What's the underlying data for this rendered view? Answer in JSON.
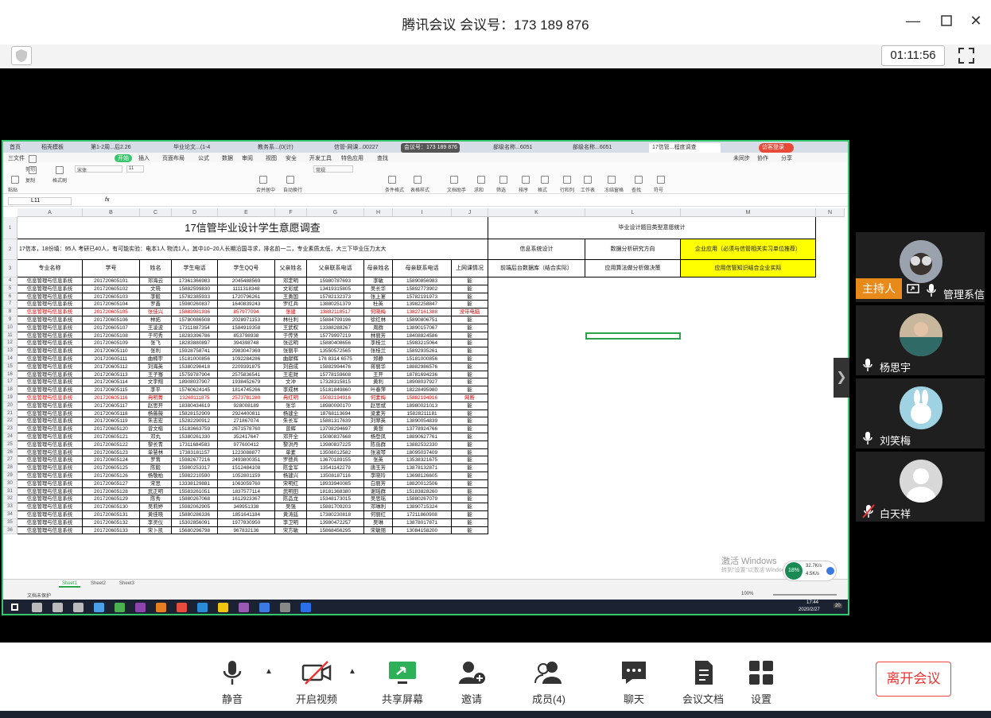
{
  "window": {
    "title": "腾讯会议 会议号：173 189 876",
    "timer": "01:11:56"
  },
  "shared_screen": {
    "tabs": [
      "首页",
      "稻壳模板",
      "第1-2周...后2.26",
      "毕业论文...(1-4",
      "教务系...(0(计)",
      "信管-网课...00227",
      "部级名称...6051",
      "部级名称...6051",
      "17信管...程度调查",
      "访客登录"
    ],
    "menus": [
      "三文件",
      "开始",
      "插入",
      "页面布局",
      "公式",
      "数据",
      "审阅",
      "视图",
      "安全",
      "开发工具",
      "特色应用",
      "查找"
    ],
    "menus_right": [
      "未同步",
      "协作",
      "分享"
    ],
    "sharing_badge": "会议号：173 189 876",
    "ribbon": {
      "font_name": "宋体",
      "font_size": "11",
      "number_format": "常规",
      "items": [
        "粘贴",
        "剪切",
        "复制",
        "格式刷",
        "合并居中",
        "自动换行",
        "条件格式",
        "表格样式",
        "文档助手",
        "求和",
        "筛选",
        "排序",
        "格式",
        "行和列",
        "工作表",
        "冻结窗格",
        "查找",
        "符号"
      ]
    },
    "name_box": "L11",
    "fx": "fx",
    "columns": [
      "A",
      "B",
      "C",
      "D",
      "E",
      "F",
      "G",
      "H",
      "I",
      "J",
      "K",
      "L",
      "M",
      "N"
    ],
    "sheet_title": "17信管毕业设计学生意愿调查",
    "summary": "17信本，18份填：95人 考研已40人，有可能实验：电本1人 物流1人，其中10~20人长期沿国寻求，排名前一二，专业素质太低，大三下毕业压力太大",
    "headers": [
      "专业名称",
      "学号",
      "姓名",
      "学生电话",
      "学生QQ号",
      "父亲姓名",
      "父亲联系电话",
      "母亲姓名",
      "母亲联系电话",
      "上网课情况"
    ],
    "side_title": "毕业设计题目类型意愿统计",
    "side_cols": [
      "信息系统设计",
      "数据分析研究方向",
      "企业应用（必须与信管相关实习单位推荐）"
    ],
    "side_row3": [
      "前端后台数据库（结合实际）",
      "应用算法做分析做决策",
      "应用信管知识结合企业实际"
    ],
    "rows": [
      [
        "信息管理与信息系统",
        "201720605101",
        "邓海云",
        "17361366983",
        "2045488569",
        "邓定明",
        "15980787693",
        "李敏",
        "15890856983",
        "能"
      ],
      [
        "信息管理与信息系统",
        "201720605102",
        "文晓",
        "15882599830",
        "1111318348",
        "文彩斌",
        "13419315805",
        "吴长华",
        "15892773902",
        "能"
      ],
      [
        "信息管理与信息系统",
        "201720605103",
        "李毅",
        "15782385933",
        "1720796261",
        "王勇国",
        "15782132373",
        "张上宴",
        "15782191973",
        "能"
      ],
      [
        "信息管理与信息系统",
        "201720605104",
        "罗鑫",
        "15980260837",
        "1640839243",
        "罗红兵",
        "13880251379",
        "杜英",
        "13982258847",
        "能"
      ],
      [
        "信息管理与信息系统",
        "201720605105",
        "张佳兴",
        "15883981936",
        "857977094",
        "张建",
        "13882118517",
        "何晓梅",
        "13827161388",
        "没带电脑"
      ],
      [
        "信息管理与信息系统",
        "201720605106",
        "林拓",
        "15780086508",
        "2028971153",
        "林仕利",
        "15884799196",
        "徐红林",
        "15890806751",
        "能"
      ],
      [
        "信息管理与信息系统",
        "201720605107",
        "王凌波",
        "17311887354",
        "1584919358",
        "王武权",
        "13388288267",
        "周群",
        "13890157067",
        "能"
      ],
      [
        "信息管理与信息系统",
        "201720605108",
        "于可秀",
        "18283396786",
        "853798938",
        "于传贤",
        "15779997219",
        "林丽芳",
        "18408824586",
        "能"
      ],
      [
        "信息管理与信息系统",
        "201720605109",
        "张飞",
        "18283880897",
        "394398748",
        "张远明",
        "15880408656",
        "李桂兰",
        "15983215064",
        "能"
      ],
      [
        "信息管理与信息系统",
        "201720605110",
        "张利",
        "15928758741",
        "2983047369",
        "张丽平",
        "13550572565",
        "张桂兰",
        "15892935261",
        "能"
      ],
      [
        "信息管理与信息系统",
        "201720605111",
        "曲楠宇",
        "15181000856",
        "1092284286",
        "曲献辉",
        "176 8314 6575",
        "郑静",
        "15181000856",
        "能"
      ],
      [
        "信息管理与信息系统",
        "201720605112",
        "刘海英",
        "15380296418",
        "2209391875",
        "刘自成",
        "15882994476",
        "蒋丽华",
        "18882986576",
        "能"
      ],
      [
        "信息管理与信息系统",
        "201720605113",
        "王子骞",
        "15759787904",
        "2575836541",
        "王宏财",
        "15778159608",
        "王开",
        "18781694236",
        "能"
      ],
      [
        "信息管理与信息系统",
        "201720605114",
        "文宇翔",
        "18908037907",
        "1938452679",
        "文冲",
        "17328315815",
        "黄利",
        "18908037927",
        "能"
      ],
      [
        "信息管理与信息系统",
        "201720605115",
        "李平",
        "15760624145",
        "1814745266",
        "李成林",
        "15181849860",
        "叶春萍",
        "18228495980",
        "能"
      ],
      [
        "信息管理与信息系统",
        "201720605116",
        "冉明菁",
        "13260111875",
        "2573781280",
        "冉红明",
        "15082194916",
        "何素梅",
        "15882194916",
        "网断"
      ],
      [
        "信息管理与信息系统",
        "201720605117",
        "赵思开",
        "18380434619",
        "928008189",
        "张华",
        "18980090170",
        "赵思斌",
        "18980021013",
        "能"
      ],
      [
        "信息管理与信息系统",
        "201720605118",
        "杨薇薇",
        "15828152909",
        "2924400811",
        "杨建全",
        "18768113694",
        "梁素芳",
        "15828211181",
        "能"
      ],
      [
        "信息管理与信息系统",
        "201720605119",
        "朱志宏",
        "15282290912",
        "271867074",
        "朱长军",
        "15881317639",
        "刘翠英",
        "13890054839",
        "能"
      ],
      [
        "信息管理与信息系统",
        "201720605120",
        "曾文楷",
        "15183663759",
        "2671578760",
        "曾辉",
        "13708294697",
        "黄想",
        "13778924766",
        "能"
      ],
      [
        "信息管理与信息系统",
        "201720605121",
        "邓丸",
        "15380261330",
        "352417647",
        "邓开全",
        "15080837668",
        "杨登凤",
        "18890627761",
        "能"
      ],
      [
        "信息管理与信息系统",
        "201720605122",
        "黎长青",
        "17311684583",
        "977600412",
        "黎洪丹",
        "13980837225",
        "陈岳群",
        "13882532330",
        "能"
      ],
      [
        "信息管理与信息系统",
        "201720605123",
        "单慧林",
        "17383181157",
        "1223088877",
        "单素",
        "13508012582",
        "张淑琴",
        "18095037409",
        "能"
      ],
      [
        "信息管理与信息系统",
        "201720605124",
        "罗茸",
        "15982677216",
        "2493800351",
        "罗德兵",
        "13670189155",
        "张英",
        "13538321675",
        "能"
      ],
      [
        "信息管理与信息系统",
        "201720605125",
        "陈毅",
        "15980253317",
        "1512484108",
        "陈金军",
        "13541142279",
        "唐玉芳",
        "13878132871",
        "能"
      ],
      [
        "信息管理与信息系统",
        "201720605126",
        "杨敬柏",
        "15982210590",
        "1052801159",
        "杨建兴",
        "13508187116",
        "李晓玲",
        "13698126605",
        "能"
      ],
      [
        "信息管理与信息系统",
        "201720605127",
        "宋思",
        "13338129881",
        "1063059760",
        "宋明红",
        "18933940085",
        "白丽芳",
        "18820012506",
        "能"
      ],
      [
        "信息管理与信息系统",
        "201720605128",
        "武正明",
        "15583261051",
        "1837577114",
        "武明田",
        "18181368380",
        "谢瑶群",
        "15183828260",
        "能"
      ],
      [
        "信息管理与信息系统",
        "201720605129",
        "陈秀",
        "15880267068",
        "1612923367",
        "陈品龙",
        "15348173015",
        "吴思瑶",
        "15880267079",
        "能"
      ],
      [
        "信息管理与信息系统",
        "201720605130",
        "吴莉婷",
        "15982062905",
        "349951338",
        "吴强",
        "15881709203",
        "邓琳利",
        "13890715324",
        "能"
      ],
      [
        "信息管理与信息系统",
        "201720605131",
        "黄佳晓",
        "15880286336",
        "1851641184",
        "黄涛廷",
        "17380230818",
        "何丽红",
        "17211860908",
        "能"
      ],
      [
        "信息管理与信息系统",
        "201720605132",
        "李灵仪",
        "15302856091",
        "1977830950",
        "李卫明",
        "13980472257",
        "吴琳",
        "13878017871",
        "能"
      ],
      [
        "信息管理与信息系统",
        "201720605133",
        "宋卜凯",
        "15680296798",
        "967832136",
        "宋方敏",
        "15868456295",
        "宋敏丽",
        "13084158200",
        "能"
      ]
    ],
    "sheets": [
      "Sheet1",
      "Sheet2",
      "Sheet3"
    ],
    "status": {
      "doc_status": "文档未保护",
      "zoom": "100%",
      "net_percent": "18%",
      "net_up": "32.7K/s",
      "net_down": "4.5K/s",
      "time": "17:44",
      "date": "2020/2/27",
      "notif_count": "20"
    },
    "watermark": "激活 Windows",
    "watermark_sub": "转到\"设置\"以激活 Windows。"
  },
  "participants": [
    {
      "name": "管理系信",
      "host_label": "主持人",
      "muted": false
    },
    {
      "name": "杨思宇",
      "muted": false
    },
    {
      "name": "刘笑梅",
      "muted": false
    },
    {
      "name": "白天祥",
      "muted": true
    }
  ],
  "toolbar": {
    "mute": "静音",
    "video": "开启视频",
    "share": "共享屏幕",
    "invite": "邀请",
    "members": "成员(4)",
    "chat": "聊天",
    "docs": "会议文档",
    "settings": "设置",
    "leave": "离开会议"
  },
  "colors": {
    "share_border": "#35c76b",
    "host_tag": "#e88a1a",
    "leave": "#e33333",
    "highlight_yellow": "#ffff00",
    "red_row": "#d00000"
  }
}
